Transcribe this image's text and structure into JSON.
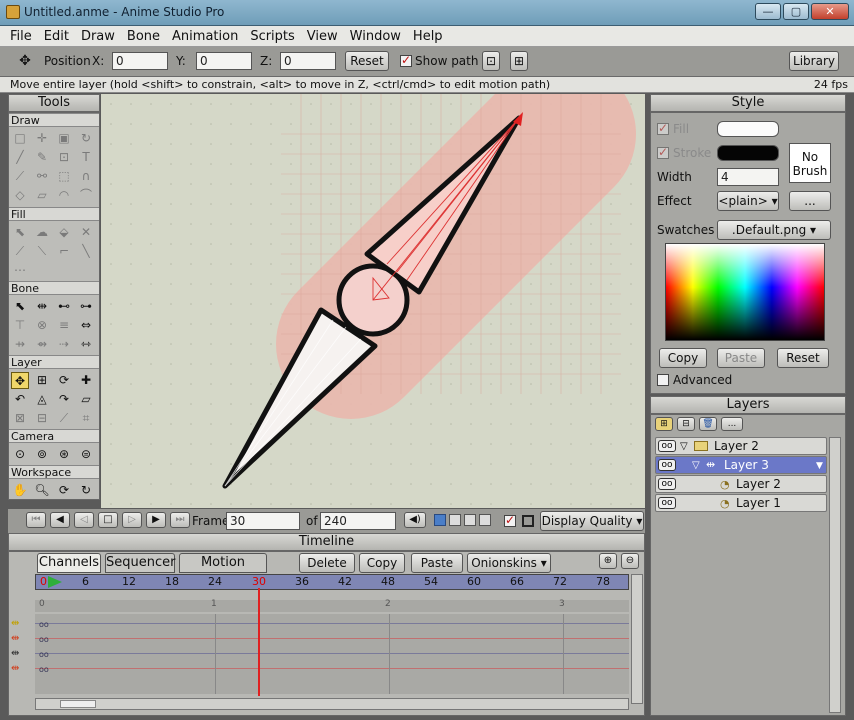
{
  "window": {
    "title": "Untitled.anme - Anime Studio Pro",
    "minimize": "—",
    "maximize": "▢",
    "close": "✕"
  },
  "menu": [
    "File",
    "Edit",
    "Draw",
    "Bone",
    "Animation",
    "Scripts",
    "View",
    "Window",
    "Help"
  ],
  "options": {
    "position_label": "Position",
    "x_label": "X:",
    "x_value": "0",
    "y_label": "Y:",
    "y_value": "0",
    "z_label": "Z:",
    "z_value": "0",
    "reset": "Reset",
    "show_path": "Show path",
    "library": "Library"
  },
  "status": {
    "message": "Move entire layer (hold <shift> to constrain, <alt> to move in Z, <ctrl/cmd> to edit motion path)",
    "fps": "24 fps"
  },
  "tools": {
    "title": "Tools",
    "sections": [
      "Draw",
      "Fill",
      "Bone",
      "Layer",
      "Camera",
      "Workspace"
    ]
  },
  "playback": {
    "frame_label": "Frame",
    "frame_value": "30",
    "of_label": "of",
    "total_value": "240",
    "display_quality": "Display Quality"
  },
  "timeline": {
    "title": "Timeline",
    "tabs": [
      "Channels",
      "Sequencer",
      "Motion Graph"
    ],
    "delete": "Delete",
    "copy": "Copy",
    "paste": "Paste",
    "onionskins": "Onionskins",
    "ruler": [
      "0",
      "6",
      "12",
      "18",
      "24",
      "30",
      "36",
      "42",
      "48",
      "54",
      "60",
      "66",
      "72",
      "78"
    ],
    "seconds": [
      "0",
      "1",
      "2",
      "3"
    ]
  },
  "style": {
    "title": "Style",
    "fill": "Fill",
    "stroke": "Stroke",
    "no_brush": "No Brush",
    "width_label": "Width",
    "width_value": "4",
    "effect_label": "Effect",
    "effect_value": "<plain>",
    "effect_more": "...",
    "swatches_label": "Swatches",
    "swatches_value": ".Default.png",
    "copy": "Copy",
    "paste": "Paste",
    "reset": "Reset",
    "advanced": "Advanced",
    "fill_color": "#ffffff",
    "stroke_color": "#000000"
  },
  "layers": {
    "title": "Layers",
    "toolbar_more": "...",
    "rows": [
      {
        "name": "Layer 2"
      },
      {
        "name": "Layer 3"
      },
      {
        "name": "Layer 2"
      },
      {
        "name": "Layer 1"
      }
    ]
  }
}
